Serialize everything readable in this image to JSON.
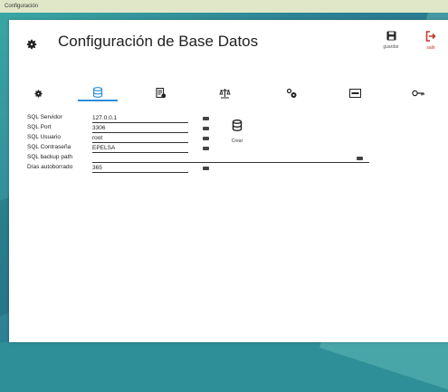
{
  "window": {
    "title": "Configuración"
  },
  "header": {
    "title": "Configuración de Base Datos"
  },
  "actions": {
    "save_label": "guardar",
    "exit_label": "salir"
  },
  "tabs": [
    {
      "icon": "gear-icon"
    },
    {
      "icon": "database-icon",
      "active": true
    },
    {
      "icon": "document-settings-icon"
    },
    {
      "icon": "scale-icon"
    },
    {
      "icon": "gears-icon"
    },
    {
      "icon": "json-icon"
    },
    {
      "icon": "key-icon"
    }
  ],
  "form": {
    "server": {
      "label": "SQL Servidor",
      "value": "127.0.0.1"
    },
    "port": {
      "label": "SQL Port",
      "value": "3306"
    },
    "user": {
      "label": "SQL Usuario",
      "value": "root"
    },
    "password": {
      "label": "SQL Contraseña",
      "value": "EPELSA"
    },
    "backup": {
      "label": "SQL backup path",
      "value": ""
    },
    "days": {
      "label": "Días autoborrado",
      "value": "365"
    }
  },
  "crear": {
    "label": "Crear"
  },
  "colors": {
    "accent": "#2a8fd8",
    "exit": "#c0392b"
  }
}
